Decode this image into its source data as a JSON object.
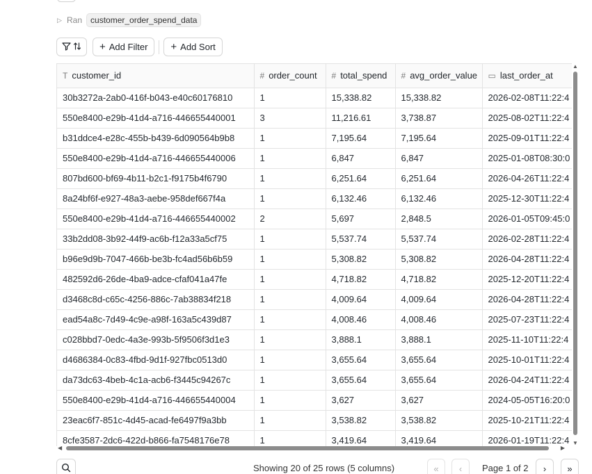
{
  "run": {
    "caret": "▷",
    "label": "Ran",
    "query_name": "customer_order_spend_data"
  },
  "toolbar": {
    "filter_sort_icon": "filter-sort-icon",
    "add_filter_label": "Add Filter",
    "add_sort_label": "Add Sort"
  },
  "table": {
    "columns": [
      {
        "icon": "T",
        "icon_name": "text-type-icon",
        "label": "customer_id"
      },
      {
        "icon": "#",
        "icon_name": "number-type-icon",
        "label": "order_count"
      },
      {
        "icon": "#",
        "icon_name": "number-type-icon",
        "label": "total_spend"
      },
      {
        "icon": "#",
        "icon_name": "number-type-icon",
        "label": "avg_order_value"
      },
      {
        "icon": "▭",
        "icon_name": "calendar-icon",
        "label": "last_order_at"
      }
    ],
    "rows": [
      [
        "30b3272a-2ab0-416f-b043-e40c60176810",
        "1",
        "15,338.82",
        "15,338.82",
        "2026-02-08T11:22:4"
      ],
      [
        "550e8400-e29b-41d4-a716-446655440001",
        "3",
        "11,216.61",
        "3,738.87",
        "2025-08-02T11:22:4"
      ],
      [
        "b31ddce4-e28c-455b-b439-6d090564b9b8",
        "1",
        "7,195.64",
        "7,195.64",
        "2025-09-01T11:22:4"
      ],
      [
        "550e8400-e29b-41d4-a716-446655440006",
        "1",
        "6,847",
        "6,847",
        "2025-01-08T08:30:0"
      ],
      [
        "807bd600-bf69-4b11-b2c1-f9175b4f6790",
        "1",
        "6,251.64",
        "6,251.64",
        "2026-04-26T11:22:4"
      ],
      [
        "8a24bf6f-e927-48a3-aebe-958def667f4a",
        "1",
        "6,132.46",
        "6,132.46",
        "2025-12-30T11:22:4"
      ],
      [
        "550e8400-e29b-41d4-a716-446655440002",
        "2",
        "5,697",
        "2,848.5",
        "2026-01-05T09:45:0"
      ],
      [
        "33b2dd08-3b92-44f9-ac6b-f12a33a5cf75",
        "1",
        "5,537.74",
        "5,537.74",
        "2026-02-28T11:22:4"
      ],
      [
        "b96e9d9b-7047-466b-be3b-fc4ad56b6b59",
        "1",
        "5,308.82",
        "5,308.82",
        "2026-04-28T11:22:4"
      ],
      [
        "482592d6-26de-4ba9-adce-cfaf041a47fe",
        "1",
        "4,718.82",
        "4,718.82",
        "2025-12-20T11:22:4"
      ],
      [
        "d3468c8d-c65c-4256-886c-7ab38834f218",
        "1",
        "4,009.64",
        "4,009.64",
        "2026-04-28T11:22:4"
      ],
      [
        "ead54a8c-7d49-4c9e-a98f-163a5c439d87",
        "1",
        "4,008.46",
        "4,008.46",
        "2025-07-23T11:22:4"
      ],
      [
        "c028bbd7-0edc-4a3e-993b-5f9506f3d1e3",
        "1",
        "3,888.1",
        "3,888.1",
        "2025-11-10T11:22:4"
      ],
      [
        "d4686384-0c83-4fbd-9d1f-927fbc0513d0",
        "1",
        "3,655.64",
        "3,655.64",
        "2025-10-01T11:22:4"
      ],
      [
        "da73dc63-4beb-4c1a-acb6-f3445c94267c",
        "1",
        "3,655.64",
        "3,655.64",
        "2026-04-24T11:22:4"
      ],
      [
        "550e8400-e29b-41d4-a716-446655440004",
        "1",
        "3,627",
        "3,627",
        "2024-05-05T16:20:0"
      ],
      [
        "23eac6f7-851c-4d45-acad-fe6497f9a3bb",
        "1",
        "3,538.82",
        "3,538.82",
        "2025-10-21T11:22:4"
      ],
      [
        "8cfe3587-2dc6-422d-b866-fa7548176e78",
        "1",
        "3,419.64",
        "3,419.64",
        "2026-01-19T11:22:4"
      ]
    ]
  },
  "footer": {
    "search_icon": "search-icon",
    "showing_text": "Showing 20 of 25 rows (5 columns)",
    "first_page_glyph": "«",
    "prev_page_glyph": "‹",
    "page_indicator": "Page 1 of 2",
    "next_page_glyph": "›",
    "last_page_glyph": "»"
  }
}
